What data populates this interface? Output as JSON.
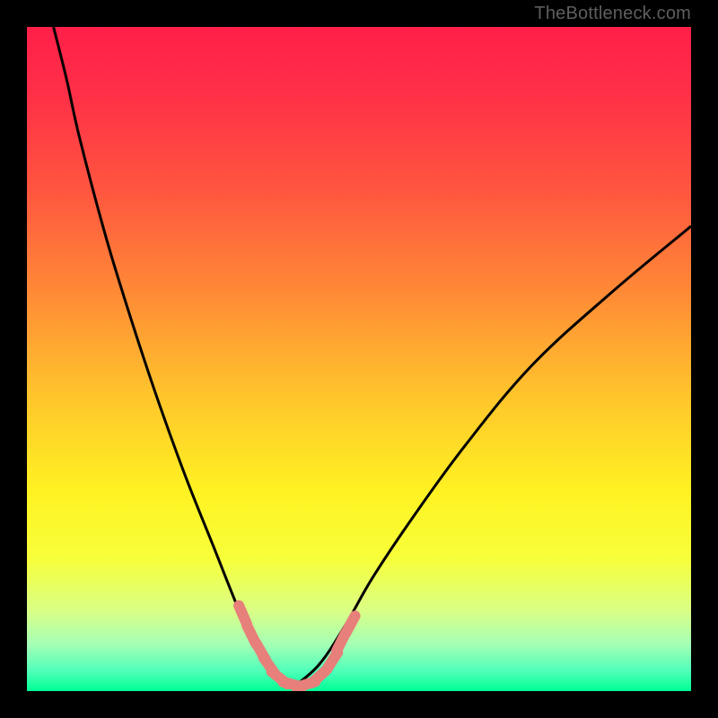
{
  "attribution": "TheBottleneck.com",
  "colors": {
    "frame": "#000000",
    "gradient_stops": [
      {
        "offset": 0.0,
        "color": "#ff1f49"
      },
      {
        "offset": 0.1,
        "color": "#ff2f47"
      },
      {
        "offset": 0.25,
        "color": "#ff573f"
      },
      {
        "offset": 0.4,
        "color": "#ff8a36"
      },
      {
        "offset": 0.55,
        "color": "#ffc32c"
      },
      {
        "offset": 0.7,
        "color": "#fff222"
      },
      {
        "offset": 0.8,
        "color": "#f7ff3a"
      },
      {
        "offset": 0.88,
        "color": "#d9ff86"
      },
      {
        "offset": 0.93,
        "color": "#a4ffb6"
      },
      {
        "offset": 0.97,
        "color": "#4fffb9"
      },
      {
        "offset": 1.0,
        "color": "#00ff94"
      }
    ],
    "curve_stroke": "#000000",
    "marker_fill": "#e77f7a",
    "attribution_text": "#5e5e5e"
  },
  "chart_data": {
    "type": "line",
    "title": "",
    "xlabel": "",
    "ylabel": "",
    "xlim": [
      0,
      100
    ],
    "ylim": [
      0,
      100
    ],
    "series": [
      {
        "name": "left-curve",
        "x": [
          4,
          6,
          8,
          12,
          16,
          20,
          24,
          28,
          32,
          34,
          36,
          38,
          40
        ],
        "y": [
          100,
          92,
          83,
          68,
          55,
          43,
          32,
          22,
          12,
          8,
          4,
          2,
          0.5
        ]
      },
      {
        "name": "right-curve",
        "x": [
          40,
          44,
          48,
          52,
          58,
          66,
          76,
          88,
          100
        ],
        "y": [
          0.5,
          4,
          10,
          17,
          26,
          37,
          49,
          60,
          70
        ]
      }
    ],
    "markers": {
      "name": "marker-dashes",
      "x": [
        32.5,
        33.8,
        35.2,
        36.5,
        38.0,
        40.0,
        42.0,
        44.0,
        46.0,
        47.3,
        48.7
      ],
      "y": [
        11.5,
        8.5,
        6.0,
        3.8,
        2.0,
        1.0,
        1.0,
        2.2,
        4.6,
        7.4,
        10.0
      ]
    }
  }
}
